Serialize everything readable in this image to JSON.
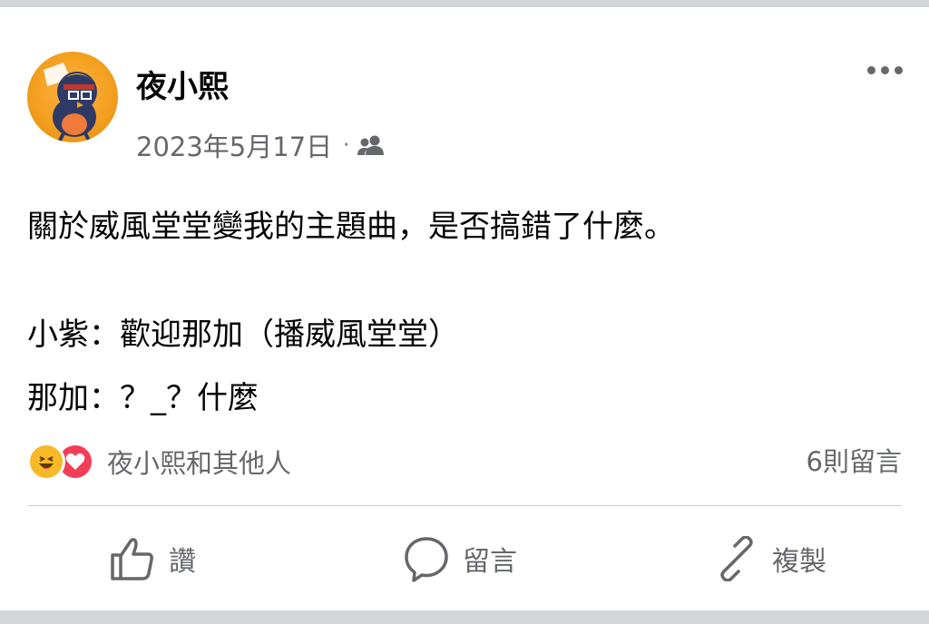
{
  "post": {
    "author": "夜小熙",
    "date": "2023年5月17日",
    "audience_icon": "friends-icon",
    "more_icon": "more-options-icon",
    "lines": [
      "關於威風堂堂變我的主題曲，是否搞錯了什麼。",
      "小紫：歡迎那加（播威風堂堂）",
      "那加：？_？什麼"
    ]
  },
  "reactions": {
    "icons": [
      "haha-icon",
      "love-icon"
    ],
    "text": "夜小熙和其他人",
    "comments": "6則留言"
  },
  "actions": {
    "like": "讚",
    "comment": "留言",
    "share": "複製"
  },
  "colors": {
    "secondary_text": "#65676b",
    "haha": "#f7b928",
    "love": "#f33e58",
    "divider": "#ced0d4"
  }
}
